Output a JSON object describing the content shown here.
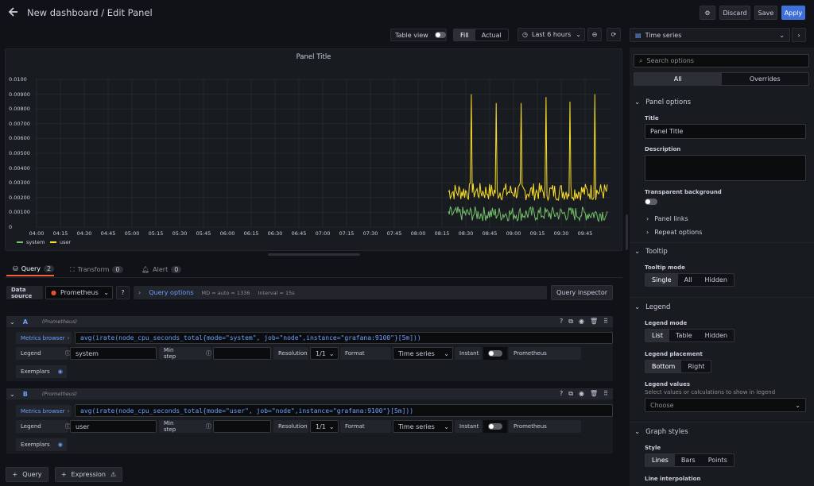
{
  "header": {
    "title": "New dashboard / Edit Panel",
    "discard": "Discard",
    "save": "Save",
    "apply": "Apply"
  },
  "toolbar": {
    "table_view": "Table view",
    "fill": "Fill",
    "actual": "Actual",
    "time_range": "Last 6 hours",
    "viz": "Time series"
  },
  "panel": {
    "title": "Panel Title",
    "yticks": [
      "0.0100",
      "0.00900",
      "0.00800",
      "0.00700",
      "0.00600",
      "0.00500",
      "0.00400",
      "0.00300",
      "0.00200",
      "0.00100",
      "0"
    ],
    "xticks": [
      "04:00",
      "04:15",
      "04:30",
      "04:45",
      "05:00",
      "05:15",
      "05:30",
      "05:45",
      "06:00",
      "06:15",
      "06:30",
      "06:45",
      "07:00",
      "07:15",
      "07:30",
      "07:45",
      "08:00",
      "08:15",
      "08:30",
      "08:45",
      "09:00",
      "09:15",
      "09:30",
      "09:45"
    ],
    "legend": [
      {
        "name": "system",
        "color": "#73bf69"
      },
      {
        "name": "user",
        "color": "#fade2a"
      }
    ]
  },
  "chart_data": {
    "type": "line",
    "x_range": [
      "04:00",
      "09:55"
    ],
    "ylim": [
      0,
      0.01
    ],
    "series": [
      {
        "name": "system",
        "approx_range": [
          0.0004,
          0.0014
        ],
        "data_starts": "08:15"
      },
      {
        "name": "user",
        "approx_range": [
          0.0018,
          0.003
        ],
        "spikes": [
          0.009,
          0.0084,
          0.0084,
          0.0088,
          0.0085,
          0.009
        ],
        "data_starts": "08:15"
      }
    ],
    "grid": true,
    "legend": "bottom-left"
  },
  "tabs": {
    "query": "Query",
    "query_count": "2",
    "transform": "Transform",
    "transform_count": "0",
    "alert": "Alert",
    "alert_count": "0"
  },
  "datasource": {
    "label": "Data source",
    "value": "Prometheus",
    "query_options": "Query options",
    "md": "MD = auto = 1336",
    "interval": "Interval = 15s",
    "inspector": "Query inspector"
  },
  "queries": [
    {
      "letter": "A",
      "ds": "(Prometheus)",
      "metrics": "Metrics browser",
      "expr": "avg(irate(node_cpu_seconds_total{mode=\"system\", job=\"node\",instance=\"grafana:9100\"}[5m]))",
      "legend_label": "Legend",
      "legend": "system",
      "minstep_label": "Min step",
      "resolution_label": "Resolution",
      "resolution": "1/1",
      "format_label": "Format",
      "format": "Time series",
      "instant": "Instant",
      "prom": "Prometheus",
      "exemplars": "Exemplars"
    },
    {
      "letter": "B",
      "ds": "(Prometheus)",
      "metrics": "Metrics browser",
      "expr": "avg(irate(node_cpu_seconds_total{mode=\"user\", job=\"node\",instance=\"grafana:9100\"}[5m]))",
      "legend_label": "Legend",
      "legend": "user",
      "minstep_label": "Min step",
      "resolution_label": "Resolution",
      "resolution": "1/1",
      "format_label": "Format",
      "format": "Time series",
      "instant": "Instant",
      "prom": "Prometheus",
      "exemplars": "Exemplars"
    }
  ],
  "bottom": {
    "add_query": "Query",
    "add_expr": "Expression"
  },
  "options": {
    "search_placeholder": "Search options",
    "all": "All",
    "overrides": "Overrides",
    "panel_options": "Panel options",
    "title_label": "Title",
    "title_value": "Panel Title",
    "description": "Description",
    "transparent": "Transparent background",
    "panel_links": "Panel links",
    "repeat": "Repeat options",
    "tooltip": "Tooltip",
    "tooltip_mode": "Tooltip mode",
    "single": "Single",
    "all_mode": "All",
    "hidden": "Hidden",
    "legend": "Legend",
    "legend_mode": "Legend mode",
    "list": "List",
    "table": "Table",
    "hidden2": "Hidden",
    "placement": "Legend placement",
    "bottom": "Bottom",
    "right": "Right",
    "values": "Legend values",
    "values_desc": "Select values or calculations to show in legend",
    "choose": "Choose",
    "graph_styles": "Graph styles",
    "style": "Style",
    "lines": "Lines",
    "bars": "Bars",
    "points": "Points",
    "interp": "Line interpolation"
  }
}
